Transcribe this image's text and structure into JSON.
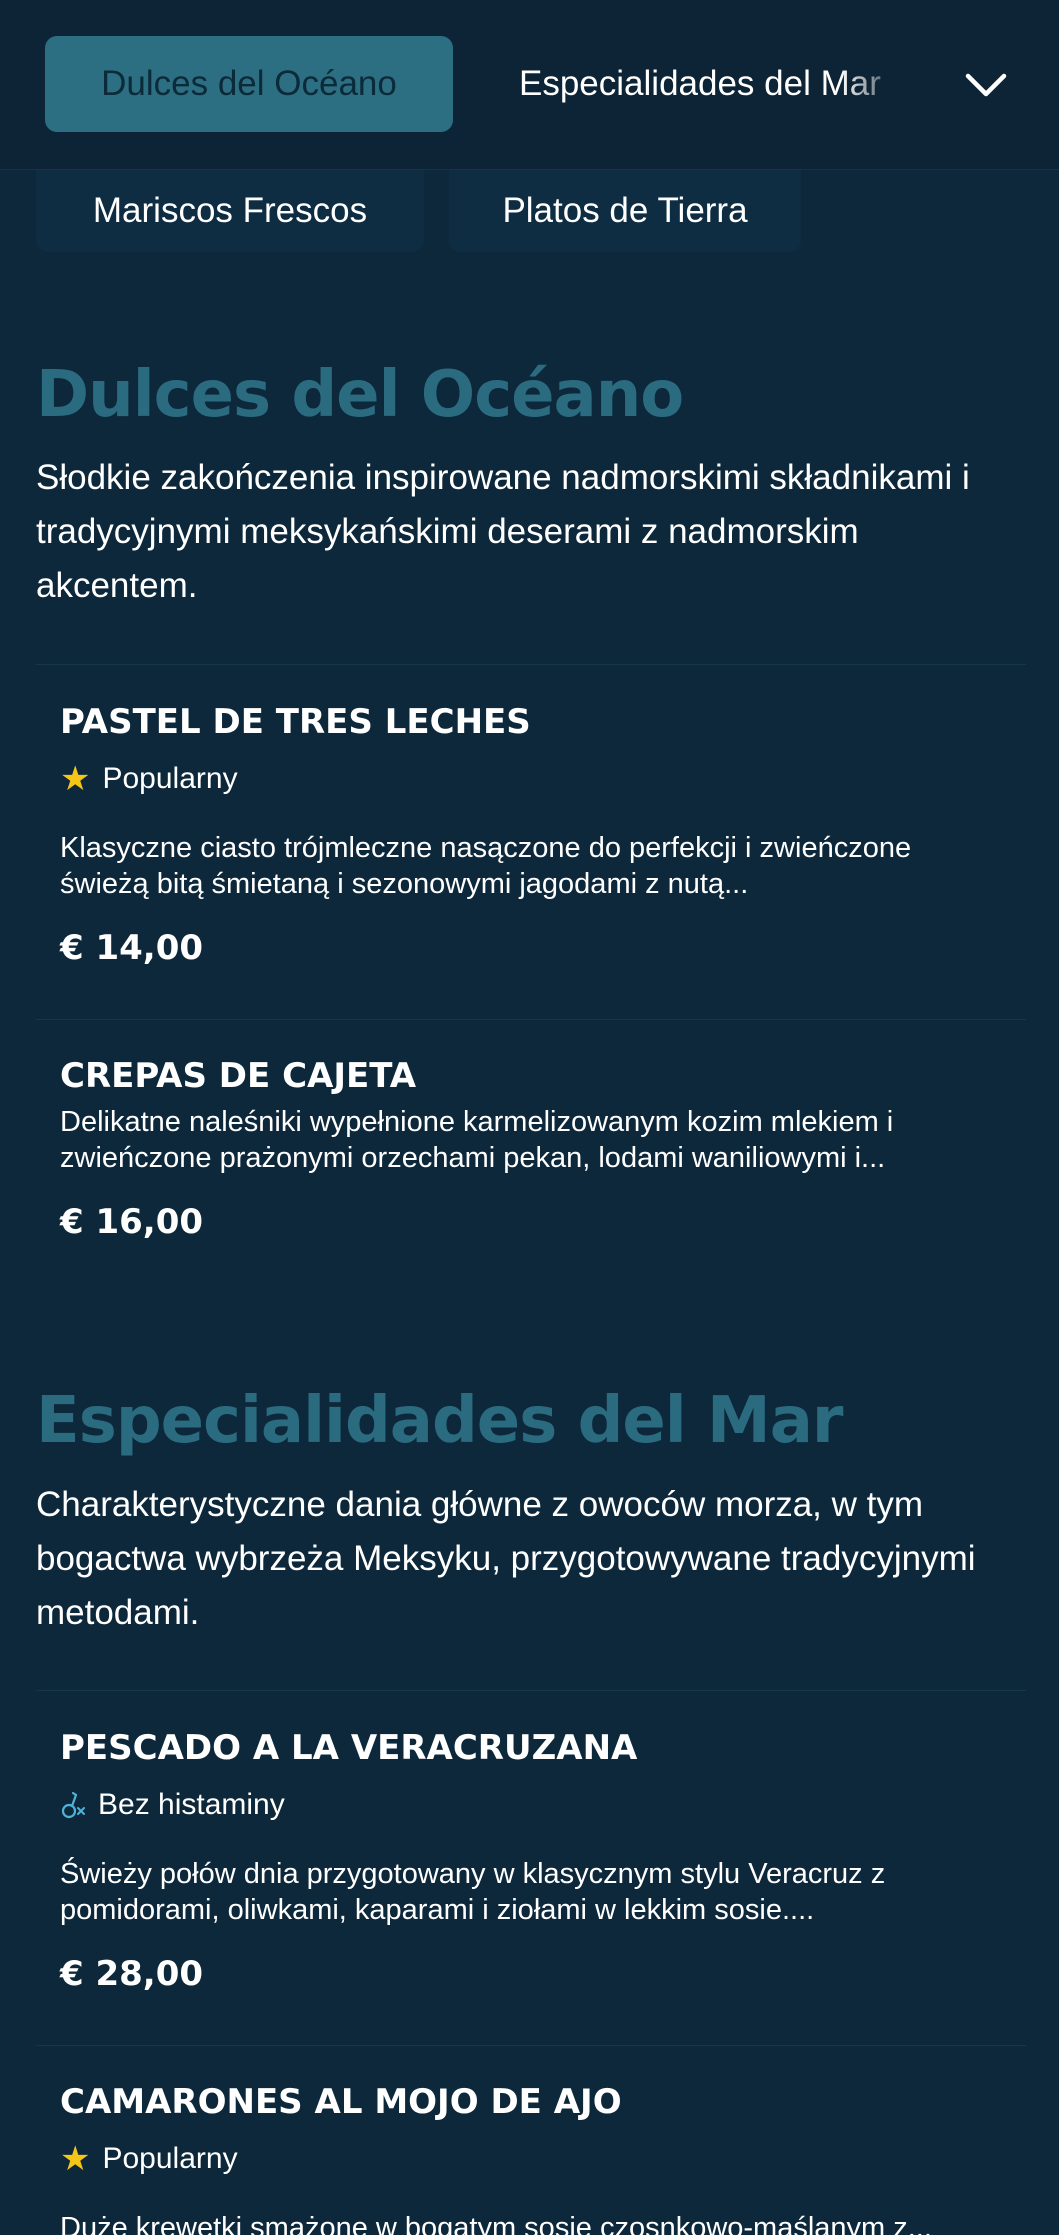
{
  "nav": {
    "categories": [
      "Dulces del Océano",
      "Especialidades del Mar",
      "Mariscos Frescos",
      "Platos de Tierra"
    ],
    "active_index": 0,
    "expand_icon": "chevron-down-icon"
  },
  "sections": [
    {
      "title": "Dulces del Océano",
      "description": "Słodkie zakończenia inspirowane nadmorskimi składnikami i tradycyjnymi meksykańskimi deserami z nadmorskim akcentem.",
      "items": [
        {
          "name": "PASTEL DE TRES LECHES",
          "badge": "Popularny",
          "badge_icon": "star-icon",
          "description": "Klasyczne ciasto trójmleczne nasączone do perfekcji i zwieńczone świeżą bitą śmietaną i sezonowymi jagodami z nutą...",
          "price": "€ 14,00"
        },
        {
          "name": "CREPAS DE CAJETA",
          "description": "Delikatne naleśniki wypełnione karmelizowanym kozim mlekiem i zwieńczone prażonymi orzechami pekan, lodami waniliowymi i...",
          "price": "€ 16,00"
        }
      ]
    },
    {
      "title": "Especialidades del Mar",
      "description": "Charakterystyczne dania główne z owoców morza, w tym bogactwa wybrzeża Meksyku, przygotowywane tradycyjnymi metodami.",
      "items": [
        {
          "name": "PESCADO A LA VERACRUZANA",
          "badge": "Bez histaminy",
          "badge_icon": "histamine-free-icon",
          "description": "Świeży połów dnia przygotowany w klasycznym stylu Veracruz z pomidorami, oliwkami, kaparami i ziołami w lekkim sosie....",
          "price": "€ 28,00"
        },
        {
          "name": "CAMARONES AL MOJO DE AJO",
          "badge": "Popularny",
          "badge_icon": "star-icon",
          "description": "Duże krewetki smażone w bogatym sosie czosnkowo-maślanym z...",
          "price": ""
        }
      ]
    }
  ],
  "colors": {
    "background": "#0d283b",
    "accent": "#2d6f82",
    "heading": "#2b6b80",
    "star": "#f5c518"
  }
}
